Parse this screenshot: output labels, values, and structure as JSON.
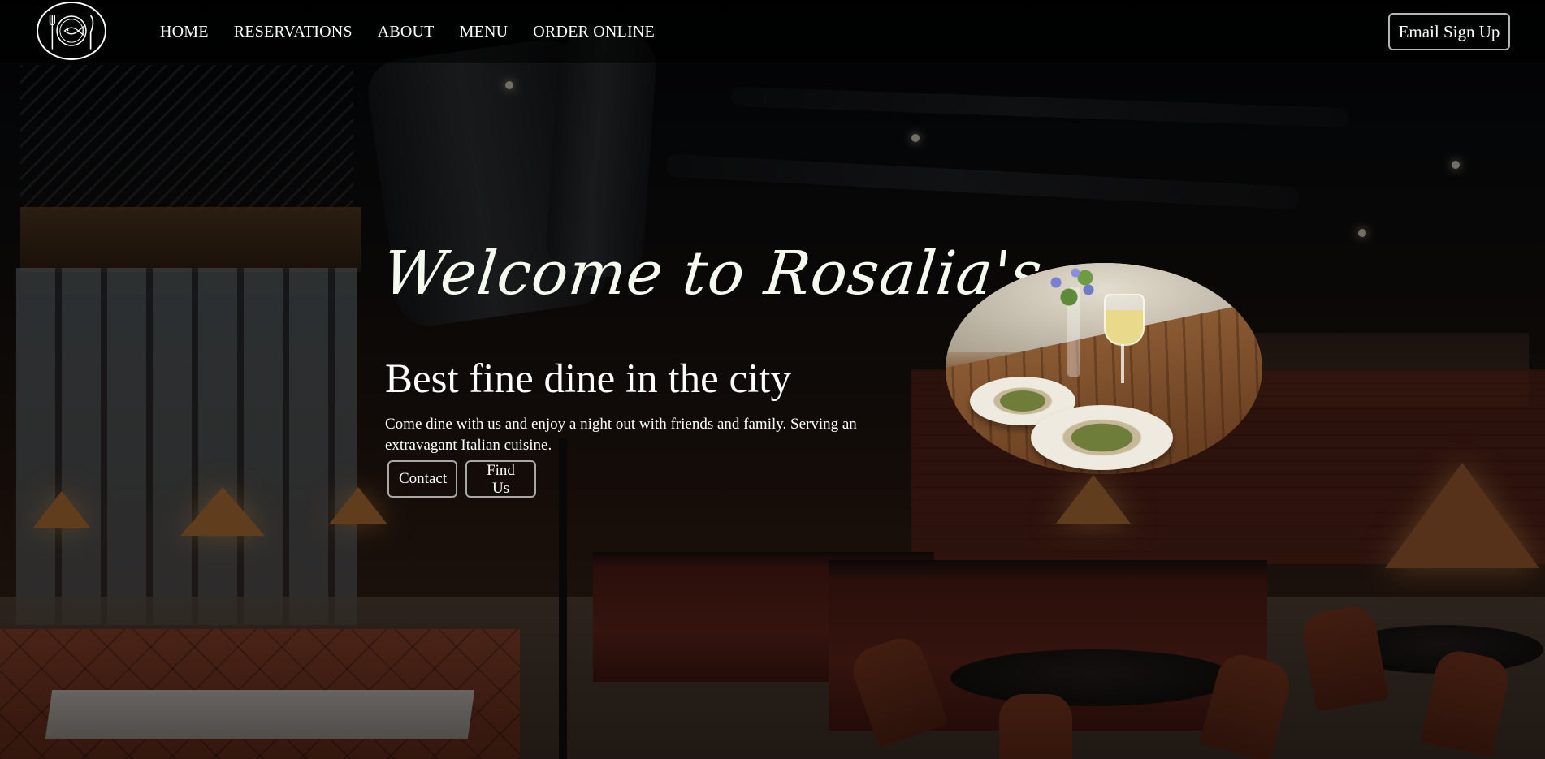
{
  "header": {
    "logo_icon": "plate-fork-knife-fish-icon",
    "nav_items": [
      {
        "label": "HOME"
      },
      {
        "label": "RESERVATIONS"
      },
      {
        "label": "ABOUT"
      },
      {
        "label": "MENU"
      },
      {
        "label": "ORDER ONLINE"
      }
    ],
    "email_signup_label": "Email Sign Up"
  },
  "hero": {
    "welcome": "Welcome to Rosalia's",
    "title": "Best fine dine in the city",
    "description": "Come dine with us and enjoy a night out with friends and family. Serving an extravagant Italian cuisine.",
    "buttons": {
      "contact": "Contact",
      "find_us": "Find Us"
    }
  },
  "colors": {
    "text": "#ffffff",
    "welcome_text": "#f4fbee",
    "button_border": "#a8a8a8",
    "nav_band": "rgba(0,0,0,0.55)"
  }
}
